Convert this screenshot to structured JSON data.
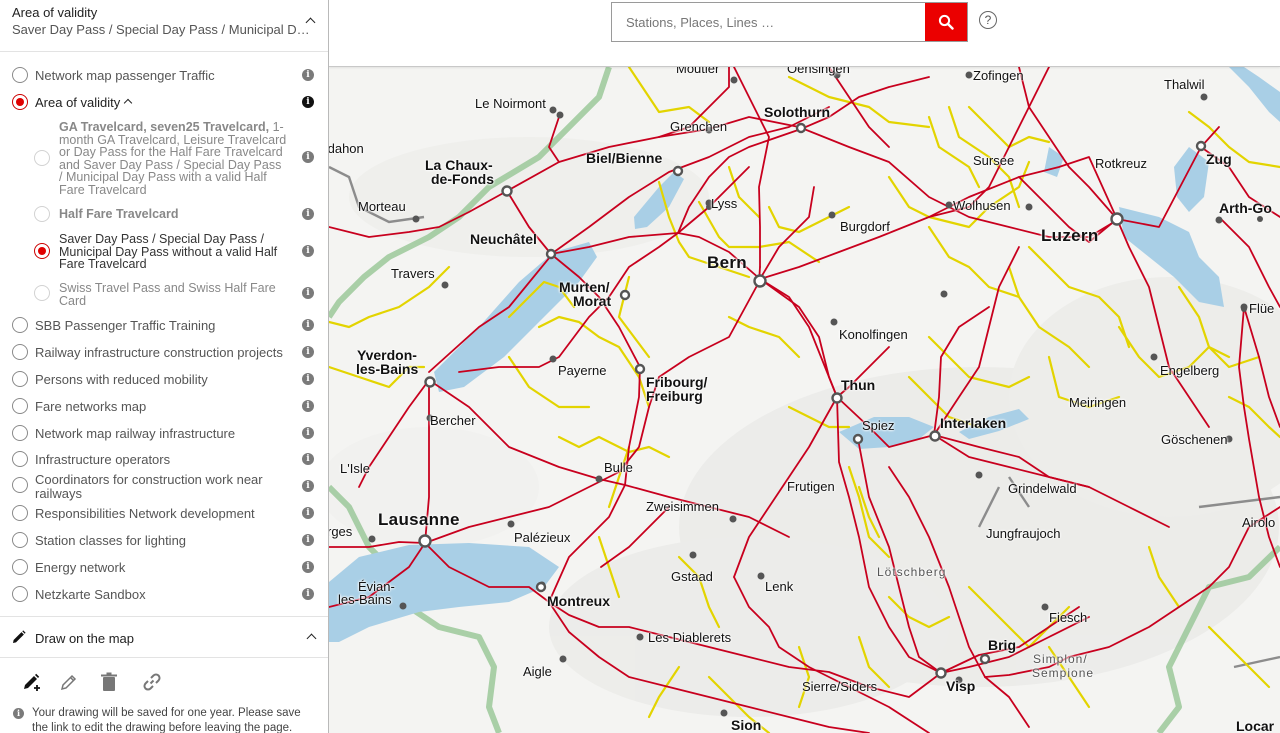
{
  "sidebar": {
    "header": {
      "title": "Area of validity",
      "subtitle": "Saver Day Pass / Special Day Pass / Municipal Day ..."
    },
    "layers": [
      {
        "label": "Network map passenger Traffic",
        "selected": false
      },
      {
        "label": "Area of validity",
        "selected": true,
        "expanded": true
      },
      {
        "label": "SBB Passenger Traffic Training",
        "selected": false
      },
      {
        "label": "Railway infrastructure construction projects",
        "selected": false
      },
      {
        "label": "Persons with reduced mobility",
        "selected": false
      },
      {
        "label": "Fare networks map",
        "selected": false
      },
      {
        "label": "Network map railway infrastructure",
        "selected": false
      },
      {
        "label": "Infrastructure operators",
        "selected": false
      },
      {
        "label": "Coordinators for construction work near railways",
        "selected": false
      },
      {
        "label": "Responsibilities Network development",
        "selected": false
      },
      {
        "label": "Station classes for lighting",
        "selected": false
      },
      {
        "label": "Energy network",
        "selected": false
      },
      {
        "label": "Netzkarte Sandbox",
        "selected": false
      }
    ],
    "sublayers": [
      {
        "bold": "GA Travelcard, seven25 Travelcard,",
        "rest": "1-month GA Travelcard, Leisure Travelcard or Day Pass for the Half Fare Travelcard and Saver Day Pass / Special Day Pass / Municipal Day Pass with a valid Half Fare Travelcard",
        "selected": false
      },
      {
        "bold": "Half Fare Travelcard",
        "rest": "",
        "selected": false
      },
      {
        "bold": "",
        "rest": "Saver Day Pass / Special Day Pass / Municipal Day Pass without a valid Half Fare Travelcard",
        "selected": true
      },
      {
        "bold": "",
        "rest": "Swiss Travel Pass and Swiss Half Fare Card",
        "selected": false
      }
    ],
    "draw": {
      "title": "Draw on the map",
      "tools": [
        "pencil-add-icon",
        "pencil-edit-icon",
        "trash-icon",
        "link-icon"
      ],
      "note": "Your drawing will be saved for one year. Please save the link to edit the drawing before leaving the page."
    },
    "info_glyph": "i"
  },
  "search": {
    "placeholder": "Stations, Places, Lines …",
    "help_glyph": "?"
  },
  "map": {
    "colors": {
      "rail": "#c8001e",
      "yellow": "#e3d400",
      "lake": "#a9cfe6",
      "border": "#9bc89a",
      "grey": "#8c8c8c"
    },
    "places": [
      {
        "name": "Moutier",
        "size": "s"
      },
      {
        "name": "Oensingen",
        "size": "s"
      },
      {
        "name": "Zofingen",
        "size": "s"
      },
      {
        "name": "Thalwil",
        "size": "s"
      },
      {
        "name": "Le Noirmont",
        "size": "s"
      },
      {
        "name": "Grenchen",
        "size": "s"
      },
      {
        "name": "Solothurn",
        "size": "m"
      },
      {
        "name": "Idahon",
        "size": "s"
      },
      {
        "name": "La Chaux-",
        "size": "m"
      },
      {
        "name": "de-Fonds",
        "size": "m"
      },
      {
        "name": "Biel/Bienne",
        "size": "m"
      },
      {
        "name": "Sursee",
        "size": "s"
      },
      {
        "name": "Rotkreuz",
        "size": "s"
      },
      {
        "name": "Zug",
        "size": "m"
      },
      {
        "name": "Morteau",
        "size": "s"
      },
      {
        "name": "Lyss",
        "size": "s"
      },
      {
        "name": "Wolhusen",
        "size": "s"
      },
      {
        "name": "Arth-Go",
        "size": "m"
      },
      {
        "name": "Burgdorf",
        "size": "s"
      },
      {
        "name": "Neuchâtel",
        "size": "m"
      },
      {
        "name": "Luzern",
        "size": "l"
      },
      {
        "name": "Bern",
        "size": "l"
      },
      {
        "name": "Travers",
        "size": "s"
      },
      {
        "name": "Murten/",
        "size": "m"
      },
      {
        "name": "Morat",
        "size": "m"
      },
      {
        "name": "Flüe",
        "size": "s"
      },
      {
        "name": "Konolfingen",
        "size": "s"
      },
      {
        "name": "Yverdon-",
        "size": "m"
      },
      {
        "name": "les-Bains",
        "size": "m"
      },
      {
        "name": "Payerne",
        "size": "s"
      },
      {
        "name": "Engelberg",
        "size": "s"
      },
      {
        "name": "Fribourg/",
        "size": "m"
      },
      {
        "name": "Freiburg",
        "size": "m"
      },
      {
        "name": "Thun",
        "size": "m"
      },
      {
        "name": "Meiringen",
        "size": "s"
      },
      {
        "name": "Bercher",
        "size": "s"
      },
      {
        "name": "Spiez",
        "size": "s"
      },
      {
        "name": "Interlaken",
        "size": "m"
      },
      {
        "name": "Göschenen",
        "size": "s"
      },
      {
        "name": "L'Isle",
        "size": "s"
      },
      {
        "name": "Bulle",
        "size": "s"
      },
      {
        "name": "Frutigen",
        "size": "s"
      },
      {
        "name": "Grindelwald",
        "size": "s"
      },
      {
        "name": "Zweisimmen",
        "size": "s"
      },
      {
        "name": "rges",
        "size": "s"
      },
      {
        "name": "Lausanne",
        "size": "l"
      },
      {
        "name": "Palézieux",
        "size": "s"
      },
      {
        "name": "Jungfraujoch",
        "size": "s"
      },
      {
        "name": "Airolo",
        "size": "s"
      },
      {
        "name": "Lötschberg",
        "size": "grey"
      },
      {
        "name": "Gstaad",
        "size": "s"
      },
      {
        "name": "Lenk",
        "size": "s"
      },
      {
        "name": "Évian-",
        "size": "s"
      },
      {
        "name": "les-Bains",
        "size": "s"
      },
      {
        "name": "Montreux",
        "size": "m"
      },
      {
        "name": "Fiesch",
        "size": "s"
      },
      {
        "name": "Les Diablerets",
        "size": "s"
      },
      {
        "name": "Brig",
        "size": "m"
      },
      {
        "name": "Simplon/",
        "size": "grey"
      },
      {
        "name": "Sempione",
        "size": "grey"
      },
      {
        "name": "Aigle",
        "size": "s"
      },
      {
        "name": "Sierre/Siders",
        "size": "s"
      },
      {
        "name": "Visp",
        "size": "m"
      },
      {
        "name": "Sion",
        "size": "m"
      },
      {
        "name": "Locar",
        "size": "m"
      }
    ]
  }
}
